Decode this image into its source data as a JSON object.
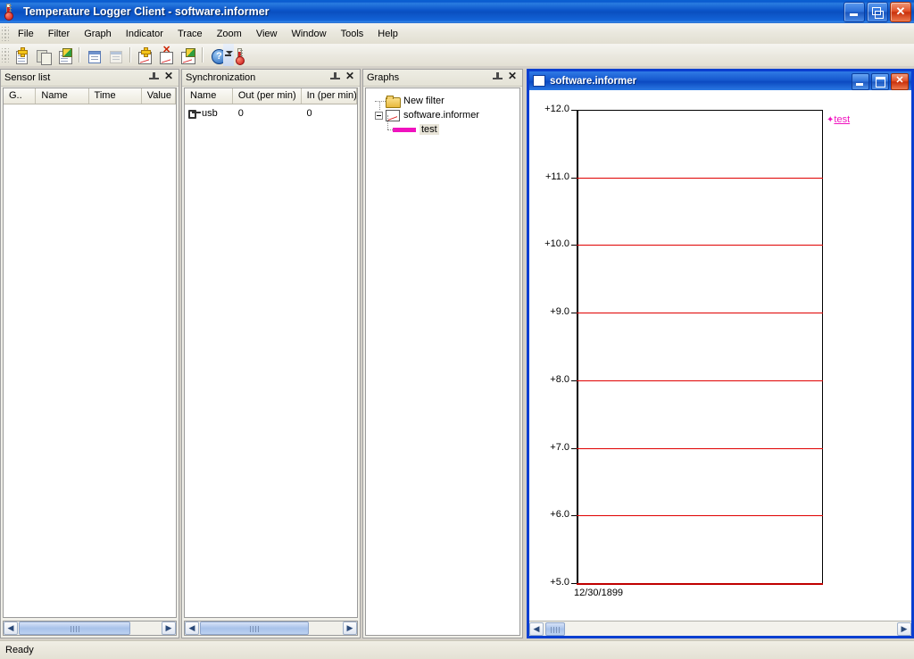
{
  "window": {
    "title": "Temperature Logger Client - software.informer",
    "icon": "thermometer-icon",
    "buttons": {
      "minimize": "_",
      "restore": "❐",
      "close": "✕"
    }
  },
  "menu": {
    "items": [
      {
        "label": "File",
        "accel": "F"
      },
      {
        "label": "Filter",
        "accel": "i"
      },
      {
        "label": "Graph",
        "accel": "G"
      },
      {
        "label": "Indicator",
        "accel": "I"
      },
      {
        "label": "Trace",
        "accel": "T"
      },
      {
        "label": "Zoom",
        "accel": "Z"
      },
      {
        "label": "View",
        "accel": "V"
      },
      {
        "label": "Window",
        "accel": "W"
      },
      {
        "label": "Tools",
        "accel": "T"
      },
      {
        "label": "Help",
        "accel": "H"
      }
    ]
  },
  "toolbar": {
    "buttons": [
      {
        "name": "new-filter-icon",
        "title": "New filter"
      },
      {
        "name": "copy-filter-icon",
        "title": "Copy"
      },
      {
        "name": "open-filter-icon",
        "title": "Open filter"
      },
      {
        "name": "properties-icon",
        "title": "Properties"
      },
      {
        "name": "properties-disabled-icon",
        "title": "Properties"
      },
      {
        "name": "new-graph-icon",
        "title": "New graph"
      },
      {
        "name": "delete-graph-icon",
        "title": "Delete graph"
      },
      {
        "name": "open-graph-icon",
        "title": "Open graph"
      },
      {
        "name": "help-icon",
        "title": "Help"
      },
      {
        "name": "thermometer-icon",
        "title": "Sensors"
      }
    ]
  },
  "sensor_panel": {
    "title": "Sensor list",
    "columns": [
      "G..",
      "Name",
      "Time",
      "Value"
    ],
    "rows": []
  },
  "sync_panel": {
    "title": "Synchronization",
    "columns": [
      "Name",
      "Out (per min)",
      "In (per min)"
    ],
    "rows": [
      {
        "icon": "usb-icon",
        "name": "usb",
        "out": "0",
        "in": "0"
      }
    ]
  },
  "graphs_panel": {
    "title": "Graphs",
    "tree": [
      {
        "label": "New filter",
        "icon": "folder-icon",
        "level": 0,
        "expander": false,
        "selected": false
      },
      {
        "label": "software.informer",
        "icon": "graph-icon",
        "level": 0,
        "expander": true,
        "selected": false
      },
      {
        "label": "test",
        "icon": "line-swatch",
        "level": 1,
        "expander": false,
        "selected": true,
        "color": "#f012be"
      }
    ]
  },
  "mdi_window": {
    "title": "software.informer",
    "buttons": {
      "minimize": "_",
      "maximize": "□",
      "close": "✕"
    }
  },
  "chart_data": {
    "type": "line",
    "title": "software.informer",
    "xlabel": "12/30/1899",
    "ylabel": "",
    "ylim": [
      5.0,
      12.0
    ],
    "ytick_labels": [
      "+12.0",
      "+11.0",
      "+10.0",
      "+9.0",
      "+8.0",
      "+7.0",
      "+6.0",
      "+5.0"
    ],
    "ytick_values": [
      12.0,
      11.0,
      10.0,
      9.0,
      8.0,
      7.0,
      6.0,
      5.0
    ],
    "xtick_labels": [
      "12/30/1899"
    ],
    "grid": true,
    "grid_color": "#e00000",
    "axis_color": "#000000",
    "legend_position": "right",
    "series": [
      {
        "name": "test",
        "color": "#f012be",
        "marker": "+",
        "values": [],
        "x": []
      }
    ]
  },
  "statusbar": {
    "text": "Ready"
  }
}
